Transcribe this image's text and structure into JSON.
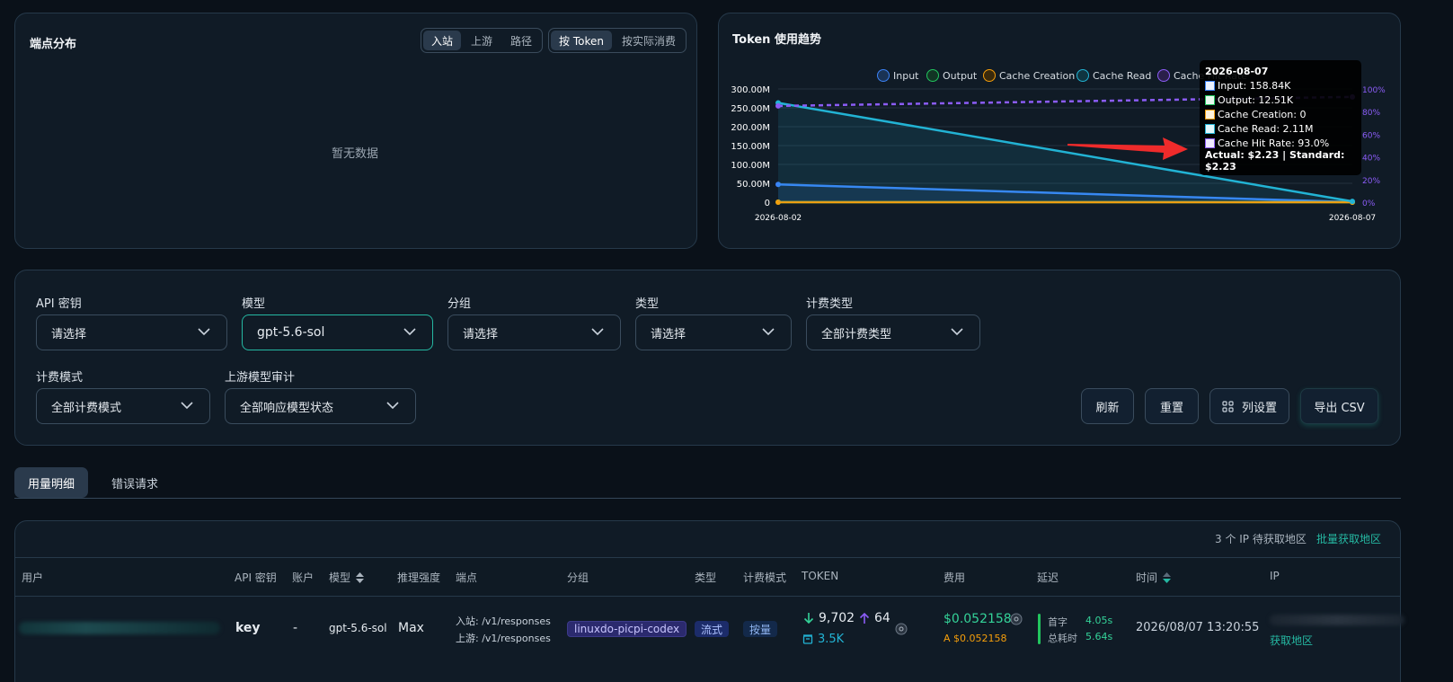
{
  "endpoint_panel": {
    "title": "端点分布",
    "seg_a": [
      "入站",
      "上游",
      "路径"
    ],
    "seg_b": [
      "按 Token",
      "按实际消费"
    ],
    "empty": "暂无数据"
  },
  "trend_panel": {
    "title": "Token 使用趋势"
  },
  "chart_data": {
    "type": "line",
    "title": "Token 使用趋势",
    "x": [
      "2026-08-02",
      "2026-08-07"
    ],
    "series": [
      {
        "name": "Input",
        "values": [
          47000000,
          158840
        ],
        "color": "#3b82f6",
        "axis": "left"
      },
      {
        "name": "Output",
        "values": [
          0,
          12510
        ],
        "color": "#22c55e",
        "axis": "left"
      },
      {
        "name": "Cache Creation",
        "values": [
          0,
          0
        ],
        "color": "#f59e0b",
        "axis": "left"
      },
      {
        "name": "Cache Read",
        "values": [
          263000000,
          2110000
        ],
        "color": "#22b3d4",
        "axis": "left"
      },
      {
        "name": "Cache Hit Rate",
        "values": [
          85,
          93
        ],
        "color": "#8b5cf6",
        "axis": "right",
        "unit": "%"
      }
    ],
    "y_left_ticks": [
      "300.00M",
      "250.00M",
      "200.00M",
      "150.00M",
      "100.00M",
      "50.00M",
      "0"
    ],
    "y_left_range": [
      0,
      300000000
    ],
    "y_right_ticks": [
      "100%",
      "80%",
      "60%",
      "40%",
      "20%",
      "0%"
    ],
    "y_right_range": [
      0,
      100
    ],
    "legend_labels": [
      "Input",
      "Output",
      "Cache Creation",
      "Cache Read",
      "Cache Hit Rate"
    ],
    "legend_position": "top",
    "grid": true,
    "tooltip": {
      "date": "2026-08-07",
      "lines": [
        "Input: 158.84K",
        "Output: 12.51K",
        "Cache Creation: 0",
        "Cache Read: 2.11M",
        "Cache Hit Rate: 93.0%"
      ],
      "footer": "Actual: $2.23 | Standard: $2.23"
    }
  },
  "filters": {
    "api_key": {
      "label": "API 密钥",
      "value": "请选择"
    },
    "model": {
      "label": "模型",
      "value": "gpt-5.6-sol"
    },
    "group": {
      "label": "分组",
      "value": "请选择"
    },
    "type": {
      "label": "类型",
      "value": "请选择"
    },
    "billing_type": {
      "label": "计费类型",
      "value": "全部计费类型"
    },
    "billing_mode": {
      "label": "计费模式",
      "value": "全部计费模式"
    },
    "upstream_audit": {
      "label": "上游模型审计",
      "value": "全部响应模型状态"
    }
  },
  "actions": {
    "refresh": "刷新",
    "reset": "重置",
    "columns": "列设置",
    "export": "导出 CSV"
  },
  "tabs": {
    "usage": "用量明细",
    "errors": "错误请求"
  },
  "table": {
    "ip_pending": "3 个 IP 待获取地区",
    "batch_fetch": "批量获取地区",
    "headers": [
      "用户",
      "API 密钥",
      "账户",
      "模型",
      "推理强度",
      "端点",
      "分组",
      "类型",
      "计费模式",
      "TOKEN",
      "费用",
      "延迟",
      "时间",
      "IP"
    ],
    "row": {
      "api_key": "key",
      "account": "-",
      "model": "gpt-5.6-sol",
      "effort": "Max",
      "endpoint_in": "入站: /v1/responses",
      "endpoint_up": "上游: /v1/responses",
      "group": "linuxdo-picpi-codex",
      "type": "流式",
      "billing_mode": "按量",
      "tokens_in": "9,702",
      "tokens_out": "64",
      "tokens_cache": "3.5K",
      "cost": "$0.052158",
      "cost_actual": "A $0.052158",
      "latency_first_label": "首字",
      "latency_first": "4.05s",
      "latency_total_label": "总耗时",
      "latency_total": "5.64s",
      "time": "2026/08/07 13:20:55",
      "ip_fetch": "获取地区"
    }
  },
  "colors": {
    "accent": "#25b8a2",
    "page_bg": "#0a1119",
    "panel_bg": "#101b26",
    "border": "#26394a",
    "cost_green": "#34d399",
    "cost_orange": "#f59e0b"
  }
}
